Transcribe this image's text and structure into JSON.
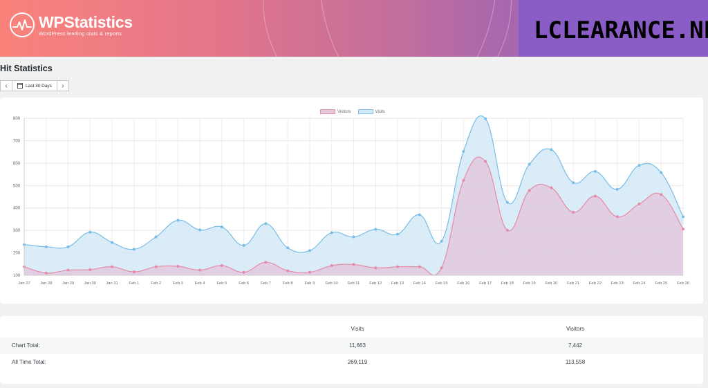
{
  "header": {
    "logo_title": "WPStatistics",
    "logo_subtitle": "WordPress leading stats & reports",
    "watermark": "LCLEARANCE.NET"
  },
  "page_title": "Hit Statistics",
  "date_picker": {
    "prev": "‹",
    "next": "›",
    "range_label": "Last 30 Days"
  },
  "colors": {
    "visits_line": "#79bde5",
    "visits_fill": "#d4e9f7",
    "visitors_line": "#e58ba6",
    "visitors_fill": "#e2c9de"
  },
  "chart_data": {
    "type": "area",
    "x": [
      "Jan 27",
      "Jan 28",
      "Jan 29",
      "Jan 30",
      "Jan 31",
      "Feb 1",
      "Feb 2",
      "Feb 3",
      "Feb 4",
      "Feb 5",
      "Feb 6",
      "Feb 7",
      "Feb 8",
      "Feb 9",
      "Feb 10",
      "Feb 11",
      "Feb 12",
      "Feb 13",
      "Feb 14",
      "Feb 15",
      "Feb 16",
      "Feb 17",
      "Feb 18",
      "Feb 19",
      "Feb 20",
      "Feb 21",
      "Feb 22",
      "Feb 23",
      "Feb 24",
      "Feb 25",
      "Feb 26"
    ],
    "series": [
      {
        "name": "Visitors",
        "values": [
          138,
          110,
          123,
          125,
          138,
          115,
          138,
          140,
          123,
          143,
          113,
          158,
          120,
          113,
          143,
          148,
          133,
          138,
          138,
          133,
          523,
          608,
          301,
          478,
          490,
          381,
          453,
          361,
          418,
          460,
          306
        ]
      },
      {
        "name": "Visits",
        "values": [
          237,
          227,
          227,
          292,
          246,
          216,
          271,
          345,
          302,
          315,
          233,
          330,
          222,
          210,
          290,
          271,
          305,
          283,
          370,
          252,
          652,
          798,
          425,
          595,
          660,
          513,
          563,
          483,
          590,
          558,
          361
        ]
      }
    ],
    "ylim": [
      100,
      800
    ],
    "yticks": [
      100,
      200,
      300,
      400,
      500,
      600,
      700,
      800
    ],
    "grid": true,
    "legend": "top-center"
  },
  "totals": {
    "headers": [
      "Visits",
      "Visitors"
    ],
    "rows": [
      {
        "label": "Chart Total:",
        "visits": "11,663",
        "visitors": "7,442"
      },
      {
        "label": "All Time Total:",
        "visits": "269,119",
        "visitors": "113,558"
      }
    ]
  }
}
